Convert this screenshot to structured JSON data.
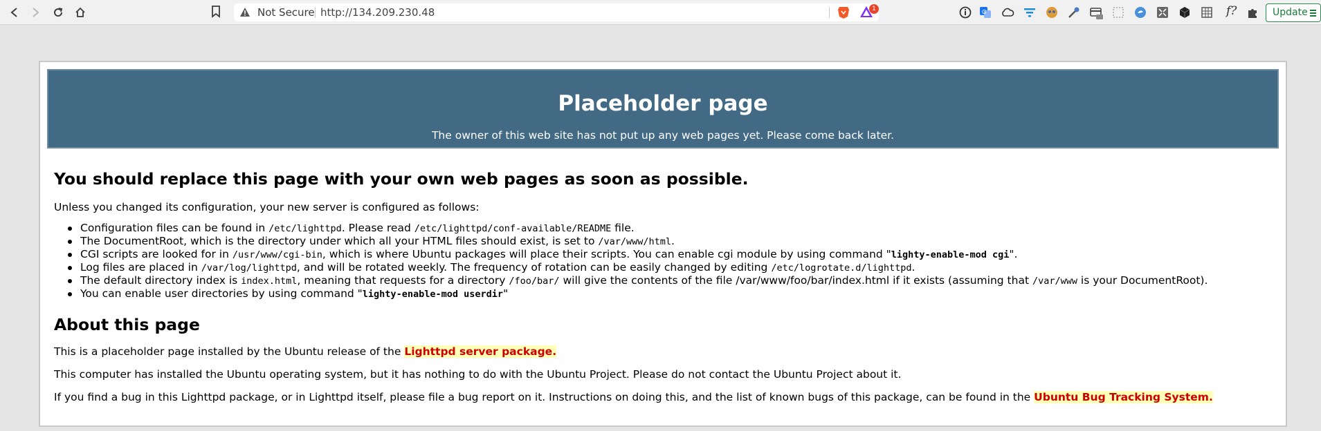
{
  "browser": {
    "not_secure_label": "Not Secure",
    "url": "http://134.209.230.48",
    "rewards_count": "1",
    "update_label": "Update",
    "extension_f_label": "f?"
  },
  "banner": {
    "title": "Placeholder page",
    "subtitle": "The owner of this web site has not put up any web pages yet. Please come back later."
  },
  "content": {
    "heading": "You should replace this page with your own web pages as soon as possible.",
    "intro": "Unless you changed its configuration, your new server is configured as follows:",
    "items": [
      {
        "t1": "Configuration files can be found in ",
        "c1": "/etc/lighttpd",
        "t2": ". Please read ",
        "c2": "/etc/lighttpd/conf-available/README",
        "t3": " file."
      },
      {
        "t1": "The DocumentRoot, which is the directory under which all your HTML files should exist, is set to ",
        "c1": "/var/www/html",
        "t2": "."
      },
      {
        "t1": "CGI scripts are looked for in ",
        "c1": "/usr/www/cgi-bin",
        "t2": ", which is where Ubuntu packages will place their scripts. You can enable cgi module by using command \"",
        "b1": "lighty-enable-mod cgi",
        "t3": "\"."
      },
      {
        "t1": "Log files are placed in ",
        "c1": "/var/log/lighttpd",
        "t2": ", and will be rotated weekly. The frequency of rotation can be easily changed by editing ",
        "c2": "/etc/logrotate.d/lighttpd",
        "t3": "."
      },
      {
        "t1": "The default directory index is ",
        "c1": "index.html",
        "t2": ", meaning that requests for a directory ",
        "c2": "/foo/bar/",
        "t3": " will give the contents of the file /var/www/foo/bar/index.html if it exists (assuming that ",
        "c3": "/var/www",
        "t4": " is your DocumentRoot)."
      },
      {
        "t1": "You can enable user directories by using command \"",
        "b1": "lighty-enable-mod userdir",
        "t2": "\""
      }
    ],
    "about_heading": "About this page",
    "about_p1_text": "This is a placeholder page installed by the Ubuntu release of the ",
    "about_p1_link": "Lighttpd server package.",
    "about_p2": "This computer has installed the Ubuntu operating system, but it has nothing to do with the Ubuntu Project. Please do not contact the Ubuntu Project about it.",
    "about_p3_text": "If you find a bug in this Lighttpd package, or in Lighttpd itself, please file a bug report on it. Instructions on doing this, and the list of known bugs of this package, can be found in the ",
    "about_p3_link": "Ubuntu Bug Tracking System."
  }
}
